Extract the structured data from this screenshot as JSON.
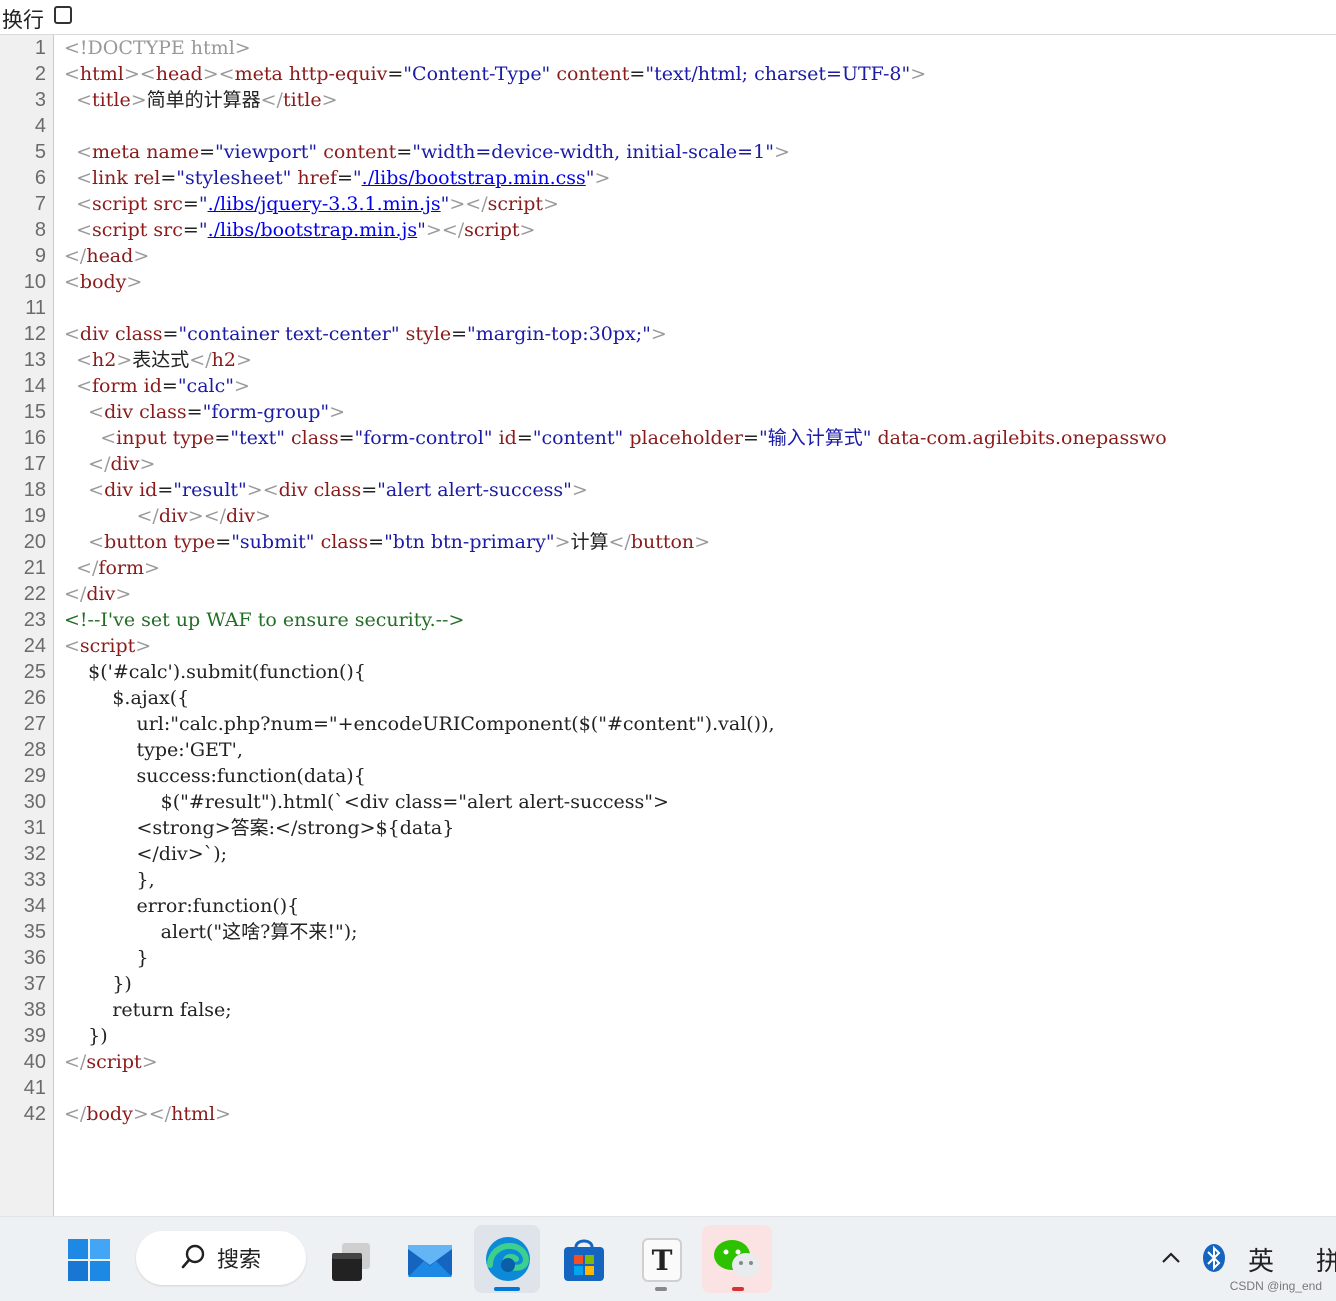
{
  "toolbar": {
    "wrap_label": "换行",
    "wrap_checked": false
  },
  "lines": [
    [
      [
        "b",
        "<!DOCTYPE html>"
      ]
    ],
    [
      [
        "b",
        "<"
      ],
      [
        "t",
        "html"
      ],
      [
        "b",
        "><"
      ],
      [
        "t",
        "head"
      ],
      [
        "b",
        "><"
      ],
      [
        "t",
        "meta "
      ],
      [
        "a",
        "http-equiv"
      ],
      [
        "k",
        "="
      ],
      [
        "v",
        "\"Content-Type\""
      ],
      [
        "k",
        " "
      ],
      [
        "a",
        "content"
      ],
      [
        "k",
        "="
      ],
      [
        "v",
        "\"text/html; charset=UTF-8\""
      ],
      [
        "b",
        ">"
      ]
    ],
    [
      [
        "k",
        "  "
      ],
      [
        "b",
        "<"
      ],
      [
        "t",
        "title"
      ],
      [
        "b",
        ">"
      ],
      [
        "k",
        "简单的计算器"
      ],
      [
        "b",
        "</"
      ],
      [
        "t",
        "title"
      ],
      [
        "b",
        ">"
      ]
    ],
    [
      [
        "k",
        ""
      ]
    ],
    [
      [
        "k",
        "  "
      ],
      [
        "b",
        "<"
      ],
      [
        "t",
        "meta "
      ],
      [
        "a",
        "name"
      ],
      [
        "k",
        "="
      ],
      [
        "v",
        "\"viewport\""
      ],
      [
        "k",
        " "
      ],
      [
        "a",
        "content"
      ],
      [
        "k",
        "="
      ],
      [
        "v",
        "\"width=device-width, initial-scale=1\""
      ],
      [
        "b",
        ">"
      ]
    ],
    [
      [
        "k",
        "  "
      ],
      [
        "b",
        "<"
      ],
      [
        "t",
        "link "
      ],
      [
        "a",
        "rel"
      ],
      [
        "k",
        "="
      ],
      [
        "v",
        "\"stylesheet\""
      ],
      [
        "k",
        " "
      ],
      [
        "a",
        "href"
      ],
      [
        "k",
        "="
      ],
      [
        "v",
        "\""
      ],
      [
        "u",
        "./libs/bootstrap.min.css"
      ],
      [
        "v",
        "\""
      ],
      [
        "b",
        ">"
      ]
    ],
    [
      [
        "k",
        "  "
      ],
      [
        "b",
        "<"
      ],
      [
        "t",
        "script "
      ],
      [
        "a",
        "src"
      ],
      [
        "k",
        "="
      ],
      [
        "v",
        "\""
      ],
      [
        "u",
        "./libs/jquery-3.3.1.min.js"
      ],
      [
        "v",
        "\""
      ],
      [
        "b",
        "></"
      ],
      [
        "t",
        "script"
      ],
      [
        "b",
        ">"
      ]
    ],
    [
      [
        "k",
        "  "
      ],
      [
        "b",
        "<"
      ],
      [
        "t",
        "script "
      ],
      [
        "a",
        "src"
      ],
      [
        "k",
        "="
      ],
      [
        "v",
        "\""
      ],
      [
        "u",
        "./libs/bootstrap.min.js"
      ],
      [
        "v",
        "\""
      ],
      [
        "b",
        "></"
      ],
      [
        "t",
        "script"
      ],
      [
        "b",
        ">"
      ]
    ],
    [
      [
        "b",
        "</"
      ],
      [
        "t",
        "head"
      ],
      [
        "b",
        ">"
      ]
    ],
    [
      [
        "b",
        "<"
      ],
      [
        "t",
        "body"
      ],
      [
        "b",
        ">"
      ]
    ],
    [
      [
        "k",
        ""
      ]
    ],
    [
      [
        "b",
        "<"
      ],
      [
        "t",
        "div "
      ],
      [
        "a",
        "class"
      ],
      [
        "k",
        "="
      ],
      [
        "v",
        "\"container text-center\""
      ],
      [
        "k",
        " "
      ],
      [
        "a",
        "style"
      ],
      [
        "k",
        "="
      ],
      [
        "v",
        "\"margin-top:30px;\""
      ],
      [
        "b",
        ">"
      ]
    ],
    [
      [
        "k",
        "  "
      ],
      [
        "b",
        "<"
      ],
      [
        "t",
        "h2"
      ],
      [
        "b",
        ">"
      ],
      [
        "k",
        "表达式"
      ],
      [
        "b",
        "</"
      ],
      [
        "t",
        "h2"
      ],
      [
        "b",
        ">"
      ]
    ],
    [
      [
        "k",
        "  "
      ],
      [
        "b",
        "<"
      ],
      [
        "t",
        "form "
      ],
      [
        "a",
        "id"
      ],
      [
        "k",
        "="
      ],
      [
        "v",
        "\"calc\""
      ],
      [
        "b",
        ">"
      ]
    ],
    [
      [
        "k",
        "    "
      ],
      [
        "b",
        "<"
      ],
      [
        "t",
        "div "
      ],
      [
        "a",
        "class"
      ],
      [
        "k",
        "="
      ],
      [
        "v",
        "\"form-group\""
      ],
      [
        "b",
        ">"
      ]
    ],
    [
      [
        "k",
        "      "
      ],
      [
        "b",
        "<"
      ],
      [
        "t",
        "input "
      ],
      [
        "a",
        "type"
      ],
      [
        "k",
        "="
      ],
      [
        "v",
        "\"text\""
      ],
      [
        "k",
        " "
      ],
      [
        "a",
        "class"
      ],
      [
        "k",
        "="
      ],
      [
        "v",
        "\"form-control\""
      ],
      [
        "k",
        " "
      ],
      [
        "a",
        "id"
      ],
      [
        "k",
        "="
      ],
      [
        "v",
        "\"content\""
      ],
      [
        "k",
        " "
      ],
      [
        "a",
        "placeholder"
      ],
      [
        "k",
        "="
      ],
      [
        "v",
        "\"输入计算式\""
      ],
      [
        "k",
        " "
      ],
      [
        "a",
        "data-com.agilebits.onepasswo"
      ]
    ],
    [
      [
        "k",
        "    "
      ],
      [
        "b",
        "</"
      ],
      [
        "t",
        "div"
      ],
      [
        "b",
        ">"
      ]
    ],
    [
      [
        "k",
        "    "
      ],
      [
        "b",
        "<"
      ],
      [
        "t",
        "div "
      ],
      [
        "a",
        "id"
      ],
      [
        "k",
        "="
      ],
      [
        "v",
        "\"result\""
      ],
      [
        "b",
        "><"
      ],
      [
        "t",
        "div "
      ],
      [
        "a",
        "class"
      ],
      [
        "k",
        "="
      ],
      [
        "v",
        "\"alert alert-success\""
      ],
      [
        "b",
        ">"
      ]
    ],
    [
      [
        "k",
        "            "
      ],
      [
        "b",
        "</"
      ],
      [
        "t",
        "div"
      ],
      [
        "b",
        "></"
      ],
      [
        "t",
        "div"
      ],
      [
        "b",
        ">"
      ]
    ],
    [
      [
        "k",
        "    "
      ],
      [
        "b",
        "<"
      ],
      [
        "t",
        "button "
      ],
      [
        "a",
        "type"
      ],
      [
        "k",
        "="
      ],
      [
        "v",
        "\"submit\""
      ],
      [
        "k",
        " "
      ],
      [
        "a",
        "class"
      ],
      [
        "k",
        "="
      ],
      [
        "v",
        "\"btn btn-primary\""
      ],
      [
        "b",
        ">"
      ],
      [
        "k",
        "计算"
      ],
      [
        "b",
        "</"
      ],
      [
        "t",
        "button"
      ],
      [
        "b",
        ">"
      ]
    ],
    [
      [
        "k",
        "  "
      ],
      [
        "b",
        "</"
      ],
      [
        "t",
        "form"
      ],
      [
        "b",
        ">"
      ]
    ],
    [
      [
        "b",
        "</"
      ],
      [
        "t",
        "div"
      ],
      [
        "b",
        ">"
      ]
    ],
    [
      [
        "c",
        "<!--I've set up WAF to ensure security.-->"
      ]
    ],
    [
      [
        "b",
        "<"
      ],
      [
        "t",
        "script"
      ],
      [
        "b",
        ">"
      ]
    ],
    [
      [
        "k",
        "    $('#calc').submit(function(){"
      ]
    ],
    [
      [
        "k",
        "        $.ajax({"
      ]
    ],
    [
      [
        "k",
        "            url:\"calc.php?num=\"+encodeURIComponent($(\"#content\").val()),"
      ]
    ],
    [
      [
        "k",
        "            type:'GET',"
      ]
    ],
    [
      [
        "k",
        "            success:function(data){"
      ]
    ],
    [
      [
        "k",
        "                $(\"#result\").html(`<div class=\"alert alert-success\">"
      ]
    ],
    [
      [
        "k",
        "            <strong>答案:</strong>${data}"
      ]
    ],
    [
      [
        "k",
        "            </div>`);"
      ]
    ],
    [
      [
        "k",
        "            },"
      ]
    ],
    [
      [
        "k",
        "            error:function(){"
      ]
    ],
    [
      [
        "k",
        "                alert(\"这啥?算不来!\");"
      ]
    ],
    [
      [
        "k",
        "            }"
      ]
    ],
    [
      [
        "k",
        "        })"
      ]
    ],
    [
      [
        "k",
        "        return false;"
      ]
    ],
    [
      [
        "k",
        "    })"
      ]
    ],
    [
      [
        "b",
        "</"
      ],
      [
        "t",
        "script"
      ],
      [
        "b",
        ">"
      ]
    ],
    [
      [
        "k",
        ""
      ]
    ],
    [
      [
        "b",
        "</"
      ],
      [
        "t",
        "body"
      ],
      [
        "b",
        "></"
      ],
      [
        "t",
        "html"
      ],
      [
        "b",
        ">"
      ]
    ]
  ],
  "taskbar": {
    "search_label": "搜索",
    "ime_label": "英",
    "ime2_label": "拼",
    "watermark": "CSDN @ing_end",
    "icons": [
      "windows-start-icon",
      "search-icon",
      "task-view-icon",
      "mail-icon",
      "edge-browser-icon",
      "microsoft-store-icon",
      "typora-icon",
      "wechat-icon",
      "chevron-up-icon",
      "bluetooth-icon"
    ],
    "accent_blue": "#0078d4",
    "accent_red": "#d13438"
  }
}
